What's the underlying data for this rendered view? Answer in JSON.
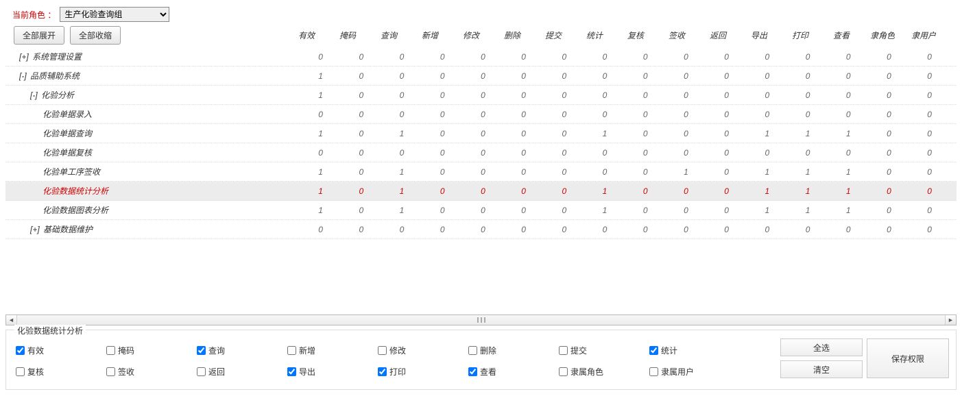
{
  "topbar": {
    "role_label": "当前角色 ：",
    "role_value": "生产化验查询组"
  },
  "toolbar": {
    "expand_all": "全部展开",
    "collapse_all": "全部收缩"
  },
  "columns": [
    "有效",
    "掩码",
    "查询",
    "新增",
    "修改",
    "删除",
    "提交",
    "统计",
    "复核",
    "签收",
    "返回",
    "导出",
    "打印",
    "查看",
    "隶角色",
    "隶用户"
  ],
  "rows": [
    {
      "indent": 0,
      "toggle": "[+]",
      "label": "系统管理设置",
      "selected": false,
      "vals": [
        0,
        0,
        0,
        0,
        0,
        0,
        0,
        0,
        0,
        0,
        0,
        0,
        0,
        0,
        0,
        0
      ]
    },
    {
      "indent": 0,
      "toggle": "[-]",
      "label": "品质辅助系统",
      "selected": false,
      "vals": [
        1,
        0,
        0,
        0,
        0,
        0,
        0,
        0,
        0,
        0,
        0,
        0,
        0,
        0,
        0,
        0
      ]
    },
    {
      "indent": 1,
      "toggle": "[-]",
      "label": "化验分析",
      "selected": false,
      "vals": [
        1,
        0,
        0,
        0,
        0,
        0,
        0,
        0,
        0,
        0,
        0,
        0,
        0,
        0,
        0,
        0
      ]
    },
    {
      "indent": 2,
      "toggle": "",
      "label": "化验单据录入",
      "selected": false,
      "vals": [
        0,
        0,
        0,
        0,
        0,
        0,
        0,
        0,
        0,
        0,
        0,
        0,
        0,
        0,
        0,
        0
      ]
    },
    {
      "indent": 2,
      "toggle": "",
      "label": "化验单据查询",
      "selected": false,
      "vals": [
        1,
        0,
        1,
        0,
        0,
        0,
        0,
        1,
        0,
        0,
        0,
        1,
        1,
        1,
        0,
        0
      ]
    },
    {
      "indent": 2,
      "toggle": "",
      "label": "化验单据复核",
      "selected": false,
      "vals": [
        0,
        0,
        0,
        0,
        0,
        0,
        0,
        0,
        0,
        0,
        0,
        0,
        0,
        0,
        0,
        0
      ]
    },
    {
      "indent": 2,
      "toggle": "",
      "label": "化验单工序签收",
      "selected": false,
      "vals": [
        1,
        0,
        1,
        0,
        0,
        0,
        0,
        0,
        0,
        1,
        0,
        1,
        1,
        1,
        0,
        0
      ]
    },
    {
      "indent": 2,
      "toggle": "",
      "label": "化验数据统计分析",
      "selected": true,
      "vals": [
        1,
        0,
        1,
        0,
        0,
        0,
        0,
        1,
        0,
        0,
        0,
        1,
        1,
        1,
        0,
        0
      ]
    },
    {
      "indent": 2,
      "toggle": "",
      "label": "化验数据图表分析",
      "selected": false,
      "vals": [
        1,
        0,
        1,
        0,
        0,
        0,
        0,
        1,
        0,
        0,
        0,
        1,
        1,
        1,
        0,
        0
      ]
    },
    {
      "indent": 1,
      "toggle": "[+]",
      "label": "基础数据维护",
      "selected": false,
      "vals": [
        0,
        0,
        0,
        0,
        0,
        0,
        0,
        0,
        0,
        0,
        0,
        0,
        0,
        0,
        0,
        0
      ]
    }
  ],
  "form": {
    "legend": "化验数据统计分析",
    "checks": [
      {
        "label": "有效",
        "checked": true
      },
      {
        "label": "掩码",
        "checked": false
      },
      {
        "label": "查询",
        "checked": true
      },
      {
        "label": "新增",
        "checked": false
      },
      {
        "label": "修改",
        "checked": false
      },
      {
        "label": "删除",
        "checked": false
      },
      {
        "label": "提交",
        "checked": false
      },
      {
        "label": "统计",
        "checked": true
      },
      {
        "label": "复核",
        "checked": false
      },
      {
        "label": "签收",
        "checked": false
      },
      {
        "label": "返回",
        "checked": false
      },
      {
        "label": "导出",
        "checked": true
      },
      {
        "label": "打印",
        "checked": true
      },
      {
        "label": "查看",
        "checked": true
      },
      {
        "label": "隶属角色",
        "checked": false
      },
      {
        "label": "隶属用户",
        "checked": false
      }
    ],
    "buttons": {
      "select_all": "全选",
      "clear": "清空",
      "save": "保存权限"
    }
  }
}
